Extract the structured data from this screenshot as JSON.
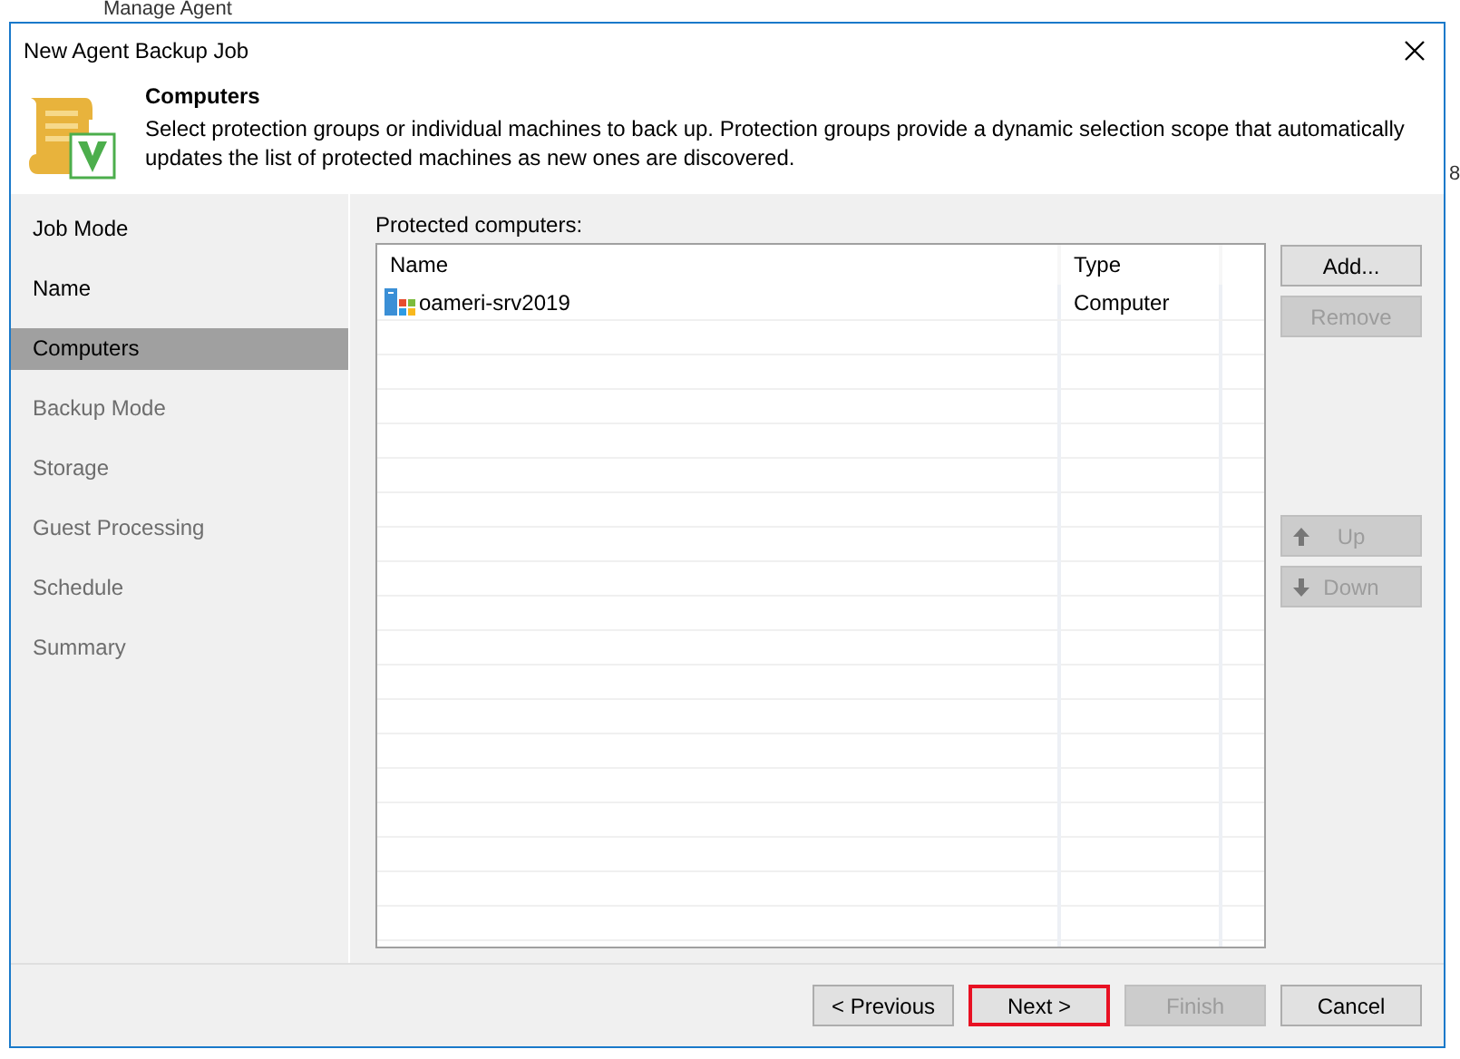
{
  "background": {
    "texts": [
      "Manage Agent",
      "8"
    ]
  },
  "window": {
    "title": "New Agent Backup Job"
  },
  "header": {
    "title": "Computers",
    "description": "Select protection groups or individual machines to back up. Protection groups provide a dynamic selection scope that automatically updates the list of protected machines as new ones are discovered."
  },
  "sidebar": {
    "items": [
      {
        "label": "Job Mode",
        "selected": false,
        "disabled": false
      },
      {
        "label": "Name",
        "selected": false,
        "disabled": false
      },
      {
        "label": "Computers",
        "selected": true,
        "disabled": false
      },
      {
        "label": "Backup Mode",
        "selected": false,
        "disabled": true
      },
      {
        "label": "Storage",
        "selected": false,
        "disabled": true
      },
      {
        "label": "Guest Processing",
        "selected": false,
        "disabled": true
      },
      {
        "label": "Schedule",
        "selected": false,
        "disabled": true
      },
      {
        "label": "Summary",
        "selected": false,
        "disabled": true
      }
    ]
  },
  "table": {
    "label": "Protected computers:",
    "columns": [
      "Name",
      "Type"
    ],
    "rows": [
      {
        "name": "oameri-srv2019",
        "type": "Computer"
      }
    ]
  },
  "side_buttons": [
    {
      "label": "Add...",
      "disabled": false,
      "kind": "plain"
    },
    {
      "label": "Remove",
      "disabled": true,
      "kind": "plain"
    },
    {
      "label": "Up",
      "disabled": true,
      "kind": "up"
    },
    {
      "label": "Down",
      "disabled": true,
      "kind": "down"
    }
  ],
  "footer_buttons": [
    {
      "label": "< Previous",
      "disabled": false,
      "highlighted": false
    },
    {
      "label": "Next >",
      "disabled": false,
      "highlighted": true
    },
    {
      "label": "Finish",
      "disabled": true,
      "highlighted": false
    },
    {
      "label": "Cancel",
      "disabled": false,
      "highlighted": false
    }
  ]
}
